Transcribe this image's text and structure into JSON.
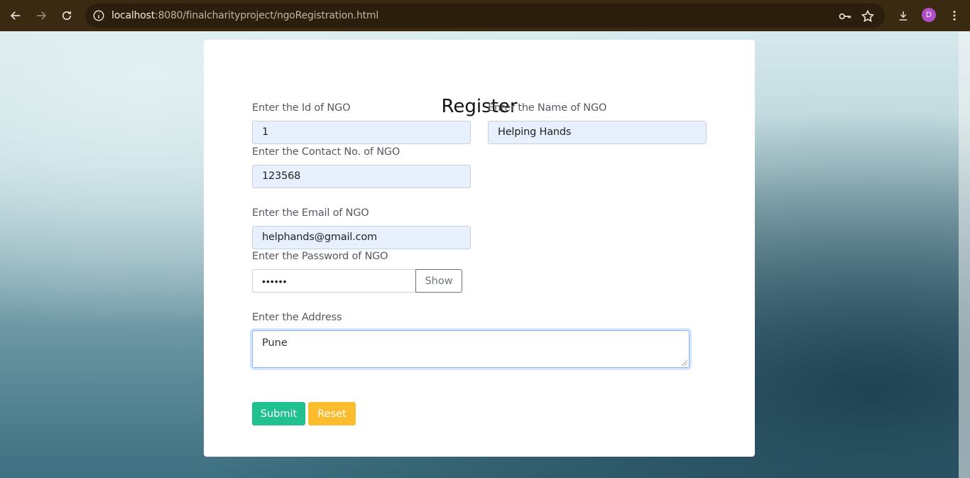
{
  "browser": {
    "url_host": "localhost",
    "url_rest": ":8080/finalcharityproject/ngoRegistration.html",
    "profile_initial": "D",
    "icons": [
      "back-icon",
      "forward-icon",
      "reload-icon",
      "info-icon",
      "key-icon",
      "star-icon",
      "download-icon",
      "more-icon"
    ]
  },
  "form": {
    "title": "Register",
    "id_label": "Enter the Id of NGO",
    "id_value": "1",
    "name_label": "Enter the Name of NGO",
    "name_value": "Helping Hands",
    "contact_label": "Enter the Contact No. of NGO",
    "contact_value": "123568",
    "email_label": "Enter the Email of NGO",
    "email_value": "helphands@gmail.com",
    "password_label": "Enter the Password of NGO",
    "password_mask": "••••••",
    "show_label": "Show",
    "address_label": "Enter the Address",
    "address_value": "Pune",
    "submit_label": "Submit",
    "reset_label": "Reset"
  },
  "colors": {
    "submit": "#20c08f",
    "reset": "#fbbd2d",
    "autofill": "#e8f0fe",
    "chrome": "#3b2a12"
  }
}
